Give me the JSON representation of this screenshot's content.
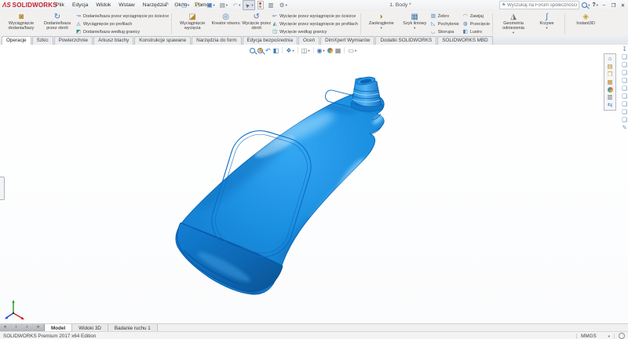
{
  "window": {
    "logo_mark": "ΛS",
    "logo_text": "SOLIDWORKS",
    "title": "1. Body *",
    "search_placeholder": "Wyszukaj na Forum społeczności",
    "help_label": "?"
  },
  "menu": {
    "items": [
      "Plik",
      "Edycja",
      "Widok",
      "Wstaw",
      "Narzędzia",
      "Okno",
      "Pomoc"
    ]
  },
  "ribbon": {
    "g1b1": "Wyciągnięcie dodania/bazy",
    "g1b2": "Dodanie/baza przez obrót",
    "g1s1": "Dodanie/baza przez wyciągnięcie po ścieżce",
    "g1s2": "Wyciągnięcie po profilach",
    "g1s3": "Dodanie/baza według granicy",
    "g2b1": "Wyciągnięcie wycięcia",
    "g2b2": "Kreator otworu",
    "g2b3": "Wycięcie przez obrót",
    "g2s1": "Wycięcie przez wyciągnięcie po ścieżce",
    "g2s2": "Wycięcie przez wyciągnięcie po profilach",
    "g2s3": "Wycięcie według granicy",
    "g3b1": "Zaokrąglenie",
    "g3b2": "Szyk liniowy",
    "g3s1": "Żebro",
    "g3s2": "Pochylenie",
    "g3s3": "Skorupa",
    "g3s4": "Zawijaj",
    "g3s5": "Przecięcie",
    "g3s6": "Lustro",
    "g4b1": "Geometria odniesienia",
    "g4b2": "Krzywe",
    "g5b1": "Instant3D"
  },
  "command_tabs": {
    "items": [
      "Operacje",
      "Szkic",
      "Powierzchnie",
      "Arkusz blachy",
      "Konstrukcje spawane",
      "Narzędzia do form",
      "Edycja bezpośrednia",
      "Oceń",
      "DimXpert Wymiarów",
      "Dodatki SOLIDWORKS",
      "SOLIDWORKS MBD"
    ],
    "active": "Operacje"
  },
  "sheet_tabs": {
    "items": [
      "Model",
      "Widoki 3D",
      "Badanie ruchu 1"
    ],
    "active": "Model"
  },
  "statusbar": {
    "app_version": "SOLIDWORKS Premium 2017 x64 Edition",
    "units": "MMGS"
  },
  "model": {
    "part_color": "#1b8fe0",
    "part_edge_color": "#0a63b2"
  },
  "icons": {
    "pin": [
      "✒",
      "#9aa0a6"
    ],
    "new": [
      "▢",
      "#4a7ebb"
    ],
    "open": [
      "❒",
      "#c9a03d"
    ],
    "save": [
      "▣",
      "#4a7ebb"
    ],
    "print": [
      "▤",
      "#6b7379"
    ],
    "undo": [
      "↶",
      "#b9bfc4"
    ],
    "select": [
      "➤",
      "#5a6570"
    ],
    "file-properties": [
      "▥",
      "#6b7379"
    ],
    "options": [
      "⚙",
      "#6b7379"
    ],
    "caret": [
      "▾",
      "#666666"
    ],
    "search-flag": [
      "⚑",
      "#6d87a8"
    ],
    "minimize": [
      "–",
      "#333333"
    ],
    "restore": [
      "❐",
      "#333333"
    ],
    "close": [
      "✕",
      "#333333"
    ],
    "boss-extrude": [
      "◙",
      "#b5892c"
    ],
    "revolve": [
      "↻",
      "#3f76b4"
    ],
    "sweep": [
      "↝",
      "#3f76b4"
    ],
    "loft": [
      "◬",
      "#2f8f8f"
    ],
    "boundary": [
      "◩",
      "#2f8f8f"
    ],
    "cut-extrude": [
      "◪",
      "#b5892c"
    ],
    "hole-wizard": [
      "◎",
      "#3f76b4"
    ],
    "revolved-cut": [
      "↺",
      "#3f76b4"
    ],
    "swept-cut": [
      "↜",
      "#3f76b4"
    ],
    "lofted-cut": [
      "◭",
      "#2f8f8f"
    ],
    "boundary-cut": [
      "◫",
      "#2f8f8f"
    ],
    "fillet": [
      "◗",
      "#b5892c"
    ],
    "linear-pattern": [
      "▦",
      "#3f76b4"
    ],
    "rib": [
      "▥",
      "#3f76b4"
    ],
    "draft": [
      "◺",
      "#3f76b4"
    ],
    "shell": [
      "◡",
      "#3f76b4"
    ],
    "wrap": [
      "◠",
      "#b5892c"
    ],
    "intersect": [
      "◍",
      "#3f76b4"
    ],
    "mirror": [
      "◧",
      "#3f76b4"
    ],
    "ref-geometry": [
      "◮",
      "#6b7379"
    ],
    "curves": [
      "∫",
      "#3f76b4"
    ],
    "instant3d": [
      "◈",
      "#c9a03d"
    ],
    "previous-view": [
      "↶",
      "#3f76b4"
    ],
    "section-view": [
      "◧",
      "#3f76b4"
    ],
    "view-orientation": [
      "❖",
      "#3f76b4"
    ],
    "display-style": [
      "◫",
      "#6b7379"
    ],
    "hide-show": [
      "◉",
      "#3f76b4"
    ],
    "apply-scene": [
      "▦",
      "#6b7379"
    ],
    "view-settings": [
      "▭",
      "#6b7379"
    ],
    "normal-to": [
      "↧",
      "#5b87b5"
    ],
    "view-cube": [
      "❑",
      "#5b87b5"
    ],
    "sketch-pencil": [
      "✎",
      "#8a9096"
    ],
    "home": [
      "⌂",
      "#4a6e9e"
    ],
    "design-library": [
      "▤",
      "#b5892c"
    ],
    "file-explorer": [
      "❒",
      "#c9a03d"
    ],
    "view-palette": [
      "▦",
      "#b5892c"
    ],
    "custom-properties": [
      "▥",
      "#6b7379"
    ],
    "forum": [
      "⇆",
      "#4a7ebb"
    ],
    "nav-first": [
      "«",
      "#3c3c3c"
    ],
    "nav-prev": [
      "‹",
      "#3c3c3c"
    ],
    "nav-next": [
      "›",
      "#3c3c3c"
    ],
    "nav-last": [
      "»",
      "#3c3c3c"
    ]
  }
}
